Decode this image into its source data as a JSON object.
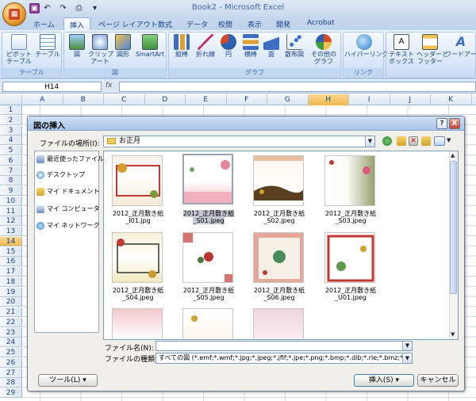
{
  "window": {
    "title": "Book2 - Microsoft Excel"
  },
  "ribbon": {
    "tabs": [
      "ホーム",
      "挿入",
      "ページ レイアウト",
      "数式",
      "データ",
      "校閲",
      "表示",
      "開発",
      "Acrobat"
    ],
    "active_tab": "挿入",
    "groups": {
      "table": {
        "label": "テーブル",
        "buttons": [
          "ピボット\nテーブル",
          "テーブル"
        ]
      },
      "illustration": {
        "label": "図",
        "buttons": [
          "図",
          "クリップ\nアート",
          "図形",
          "SmartArt"
        ]
      },
      "chart": {
        "label": "グラフ",
        "buttons": [
          "縦棒",
          "折れ線",
          "円",
          "横棒",
          "面",
          "散布図",
          "その他の\nグラフ"
        ]
      },
      "link": {
        "label": "リンク",
        "buttons": [
          "ハイパーリンク"
        ]
      },
      "text": {
        "label": "",
        "buttons": [
          "テキスト\nボックス",
          "ヘッダーと\nフッター",
          "ワードアート"
        ]
      }
    }
  },
  "formula_bar": {
    "name_box": "H14",
    "fx": "fx",
    "formula": ""
  },
  "sheet": {
    "columns": [
      "A",
      "B",
      "C",
      "D",
      "E",
      "F",
      "G",
      "H",
      "I",
      "J",
      "K"
    ],
    "selected_column": "H",
    "rows": [
      "1",
      "2",
      "3",
      "4",
      "5",
      "6",
      "7",
      "8",
      "9",
      "10",
      "11",
      "12",
      "13",
      "14",
      "15",
      "16",
      "17",
      "18",
      "19",
      "20",
      "21",
      "22",
      "23",
      "24",
      "25",
      "26",
      "27",
      "28",
      "29"
    ],
    "selected_row": "14"
  },
  "dialog": {
    "title": "図の挿入",
    "help": "?",
    "close": "X",
    "location_label": "ファイルの場所(I):",
    "location_value": "お正月",
    "places": [
      "最近使ったファイル",
      "デスクトップ",
      "マイ ドキュメント",
      "マイ コンピュータ",
      "マイ ネットワーク"
    ],
    "files": [
      {
        "name": "2012_正月敷き紙_I01.jpg",
        "selected": false
      },
      {
        "name": "2012_正月敷き紙\n_S01.jpeg",
        "selected": true
      },
      {
        "name": "2012_正月敷き紙\n_S02.jpeg",
        "selected": false
      },
      {
        "name": "2012_正月敷き紙\n_S03.jpeg",
        "selected": false
      },
      {
        "name": "2012_正月敷き紙\n_S04.jpeg",
        "selected": false
      },
      {
        "name": "2012_正月敷き紙\n_S05.jpeg",
        "selected": false
      },
      {
        "name": "2012_正月敷き紙\n_S06.jpeg",
        "selected": false
      },
      {
        "name": "2012_正月敷き紙\n_U01.jpeg",
        "selected": false
      }
    ],
    "filename_label": "ファイル名(N):",
    "filename_value": "",
    "filetype_label": "ファイルの種類(T):",
    "filetype_value": "すべての図 (*.emf;*.wmf;*.jpg;*.jpeg;*.jfif;*.jpe;*.png;*.bmp;*.dib;*.rle;*.bmz;*.gif;*.gfa;*.emz",
    "tools_button": "ツール(L)",
    "insert_button": "挿入(S)",
    "cancel_button": "キャンセル"
  },
  "colors": {
    "accent": "#15428b",
    "selection": "#f1b94c",
    "ribbon": "#dbe6f5"
  }
}
